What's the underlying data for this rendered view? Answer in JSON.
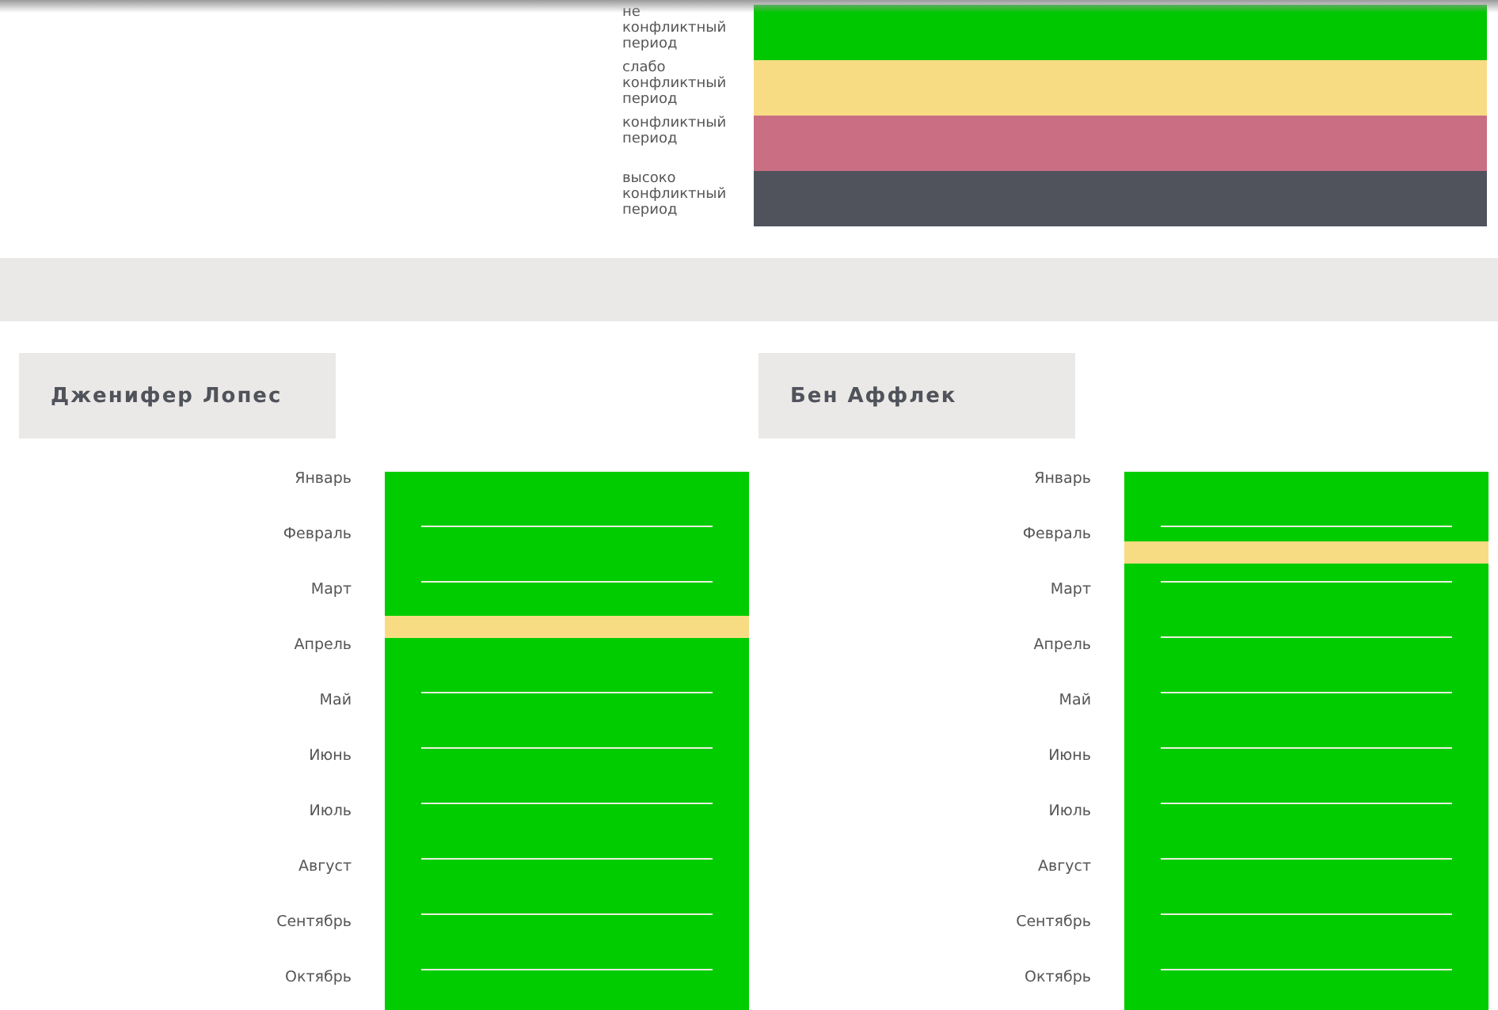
{
  "legend": [
    {
      "label": "не конфликтный период",
      "color": "#00c800"
    },
    {
      "label": "слабо конфликтный период",
      "color": "#f8dc84"
    },
    {
      "label": "конфликтный период",
      "color": "#ca6e84"
    },
    {
      "label": "высоко конфликтный период",
      "color": "#50535b"
    }
  ],
  "people": [
    {
      "name": "Дженифер Лопес",
      "months": [
        {
          "label": "Январь",
          "color": "#00cc00"
        },
        {
          "label": "Февраль",
          "color": "#00cc00"
        },
        {
          "label": "Март",
          "color": "#00cc00",
          "band": {
            "color": "#f8dc84",
            "kind": "end"
          }
        },
        {
          "label": "Апрель",
          "color": "#00cc00"
        },
        {
          "label": "Май",
          "color": "#00cc00"
        },
        {
          "label": "Июнь",
          "color": "#00cc00"
        },
        {
          "label": "Июль",
          "color": "#00cc00"
        },
        {
          "label": "Август",
          "color": "#00cc00"
        },
        {
          "label": "Сентябрь",
          "color": "#00cc00"
        },
        {
          "label": "Октябрь",
          "color": "#00cc00"
        }
      ]
    },
    {
      "name": "Бен Аффлек",
      "months": [
        {
          "label": "Январь",
          "color": "#00cc00"
        },
        {
          "label": "Февраль",
          "color": "#00cc00",
          "band": {
            "color": "#f8dc84",
            "kind": "middle"
          }
        },
        {
          "label": "Март",
          "color": "#00cc00"
        },
        {
          "label": "Апрель",
          "color": "#00cc00"
        },
        {
          "label": "Май",
          "color": "#00cc00"
        },
        {
          "label": "Июнь",
          "color": "#00cc00"
        },
        {
          "label": "Июль",
          "color": "#00cc00"
        },
        {
          "label": "Август",
          "color": "#00cc00"
        },
        {
          "label": "Сентябрь",
          "color": "#00cc00"
        },
        {
          "label": "Октябрь",
          "color": "#00cc00"
        }
      ]
    }
  ]
}
